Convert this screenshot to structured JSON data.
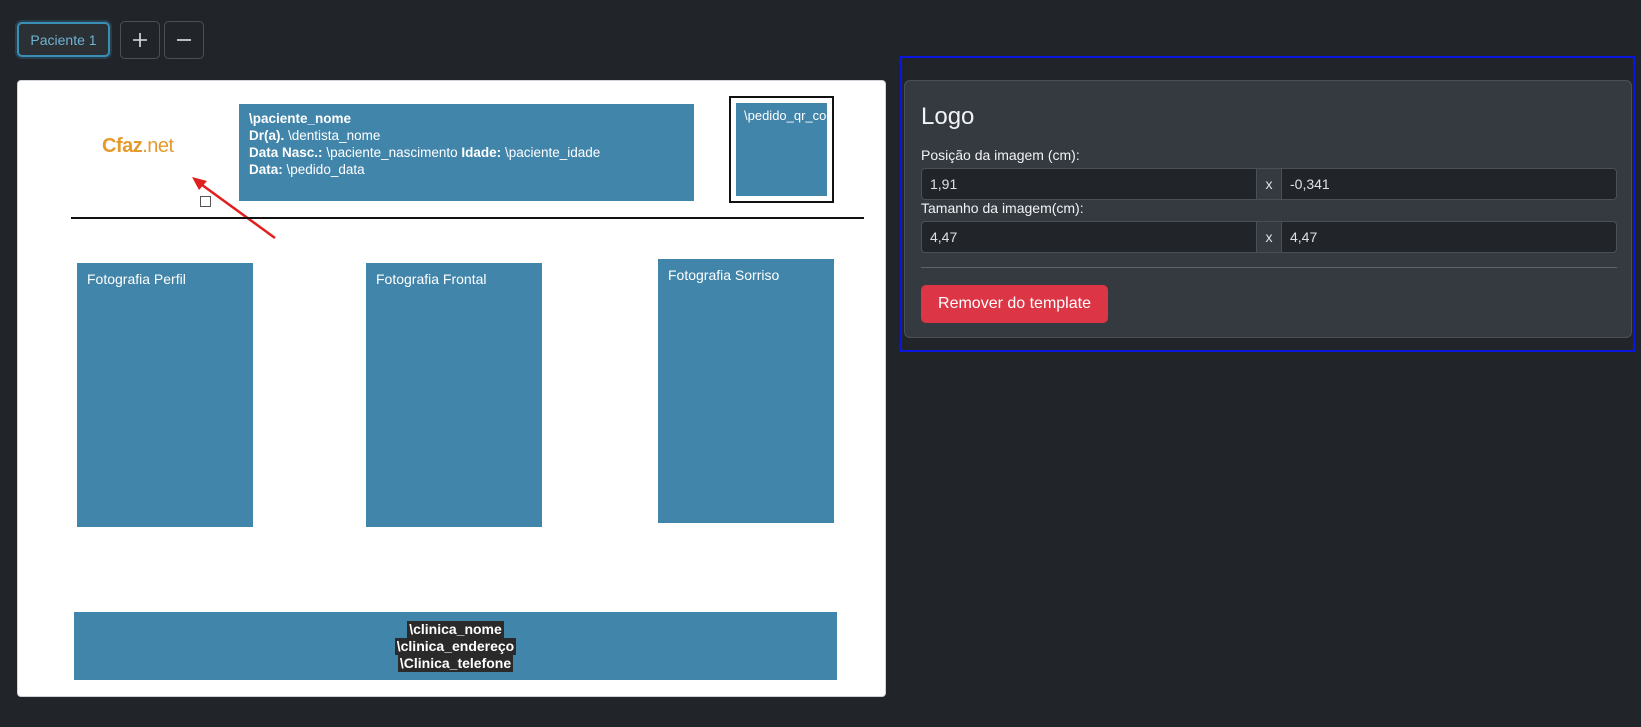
{
  "toolbar": {
    "tab_label": "Paciente 1",
    "add_icon": "plus-icon",
    "remove_icon": "minus-icon"
  },
  "document": {
    "logo": {
      "brand": "Cfaz",
      "suffix": ".net",
      "color": "#e79a2c"
    },
    "patient_box": {
      "name": "\\paciente_nome",
      "dentist_label": "Dr(a).",
      "dentist_value": "\\dentista_nome",
      "birth_label": "Data Nasc.:",
      "birth_value": "\\paciente_nascimento",
      "age_label": "Idade:",
      "age_value": "\\paciente_idade",
      "date_label": "Data:",
      "date_value": "\\pedido_data"
    },
    "qr_box": "\\pedido_qr_code",
    "photos": [
      "Fotografia Perfil",
      "Fotografia Frontal",
      "Fotografia Sorriso"
    ],
    "footer": [
      "\\clinica_nome",
      "\\clinica_endereço",
      "\\Clinica_telefone"
    ],
    "box_color": "#4185aa"
  },
  "panel": {
    "title": "Logo",
    "position_label": "Posição da imagem (cm):",
    "position_x": "1,91",
    "position_y": "-0,341",
    "size_label": "Tamanho da imagem(cm):",
    "size_w": "4,47",
    "size_h": "4,47",
    "separator": "x",
    "remove_button": "Remover do template",
    "remove_color": "#dc3545",
    "selection_color": "#0b16e0"
  }
}
